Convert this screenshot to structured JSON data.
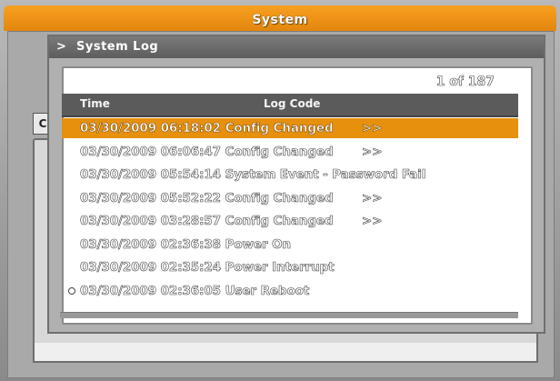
{
  "window": {
    "title": "System"
  },
  "dialog": {
    "chevron": ">",
    "title": "System Log",
    "page_indicator": "1 of 187",
    "columns": {
      "time": "Time",
      "log_code": "Log Code"
    },
    "rows": [
      {
        "text": "03/30/2009 06:18:02 Config Changed",
        "arrow": ">>",
        "selected": true
      },
      {
        "text": "03/30/2009 06:06:47 Config Changed",
        "arrow": ">>"
      },
      {
        "text": "03/30/2009 05:54:14 System Event - Password Fail",
        "arrow": ""
      },
      {
        "text": "03/30/2009 05:52:22 Config Changed",
        "arrow": ">>"
      },
      {
        "text": "03/30/2009 03:28:57 Config Changed",
        "arrow": ">>"
      },
      {
        "text": "03/30/2009 02:36:38 Power On",
        "arrow": ""
      },
      {
        "text": "03/30/2009 02:35:24 Power Interrupt",
        "arrow": ""
      },
      {
        "text": "03/30/2009 02:36:05 User Reboot",
        "arrow": "",
        "bullet": true
      }
    ]
  },
  "background_panel": {
    "tab_label": "C"
  },
  "colors": {
    "accent": "#e6900e",
    "header_bg": "#5b5b5b",
    "dialog_bg": "#b0b0b0"
  }
}
